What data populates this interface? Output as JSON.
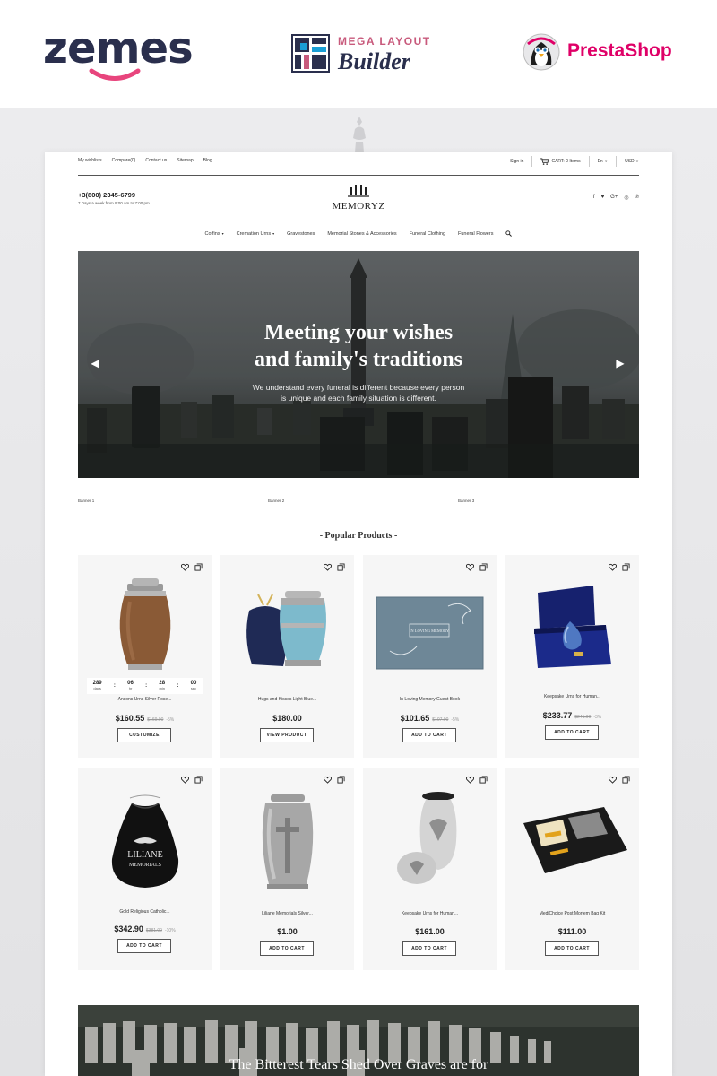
{
  "promo": {
    "zemes": "zemes",
    "mlb_top": "MEGA LAYOUT",
    "mlb_bottom": "Builder",
    "prestashop": "PrestaShop"
  },
  "topbar": {
    "links": [
      "My wishlists",
      "Compare(0)",
      "Contact us",
      "Sitemap",
      "Blog"
    ],
    "sign_in": "Sign in",
    "cart": "CART: 0 Items",
    "language": "En",
    "currency": "USD"
  },
  "header": {
    "phone": "+3(800) 2345-6799",
    "hours": "7 Days a week from 9:00 am to 7:00 pm",
    "brand": "MEMORYZ",
    "social_icons": [
      "facebook-icon",
      "twitter-icon",
      "google-plus-icon",
      "instagram-icon",
      "pinterest-icon"
    ]
  },
  "nav": {
    "items": [
      "Coffins",
      "Cremation Urns",
      "Gravestones",
      "Memorial Stones & Accessories",
      "Funeral Clothing",
      "Funeral Flowers"
    ]
  },
  "hero": {
    "title": "Meeting your wishes\nand family's traditions",
    "subtitle": "We understand every funeral is different because every person\nis unique and each family situation is different."
  },
  "banners": [
    "Banner 1",
    "Banner 2",
    "Banner 3"
  ],
  "section": {
    "title": "Popular Products"
  },
  "products": [
    {
      "name": "Ansons Urns Silver Rose...",
      "price": "$160.55",
      "old_price": "$169.00",
      "discount": "-5%",
      "button": "CUSTOMIZE",
      "countdown": [
        {
          "num": "289",
          "label": "days"
        },
        {
          "num": "06",
          "label": "hr"
        },
        {
          "num": "28",
          "label": "min"
        },
        {
          "num": "00",
          "label": "sec"
        }
      ]
    },
    {
      "name": "Hugs and Kisses Light Blue...",
      "price": "$180.00",
      "old_price": "",
      "discount": "",
      "button": "VIEW PRODUCT"
    },
    {
      "name": "In Loving Memory Guest Book",
      "price": "$101.65",
      "old_price": "$107.00",
      "discount": "-5%",
      "button": "ADD TO CART"
    },
    {
      "name": "Keepsake Urns for Human...",
      "price": "$233.77",
      "old_price": "$241.00",
      "discount": "-3%",
      "button": "ADD TO CART"
    },
    {
      "name": "Gold Religious Catholic...",
      "price": "$342.90",
      "old_price": "$381.00",
      "discount": "-10%",
      "button": "ADD TO CART"
    },
    {
      "name": "Liliane Memorials Silver...",
      "price": "$1.00",
      "old_price": "",
      "discount": "",
      "button": "ADD TO CART"
    },
    {
      "name": "Keepsake Urns for Human...",
      "price": "$161.00",
      "old_price": "",
      "discount": "",
      "button": "ADD TO CART"
    },
    {
      "name": "MediChoice Post Mortem Bag Kit",
      "price": "$111.00",
      "old_price": "",
      "discount": "",
      "button": "ADD TO CART"
    }
  ],
  "product_images": {
    "book_text": "IN LOVING MEMORY",
    "bag_text_1": "LILIANE",
    "bag_text_2": "MEMORIALS"
  },
  "bottom_banner": {
    "text": "The Bitterest Tears Shed Over Graves are for"
  },
  "colors": {
    "zemes_dark": "#2a2f4d",
    "zemes_pink": "#e8457d",
    "presta_pink": "#df0067",
    "card_bg": "#f6f6f6"
  }
}
